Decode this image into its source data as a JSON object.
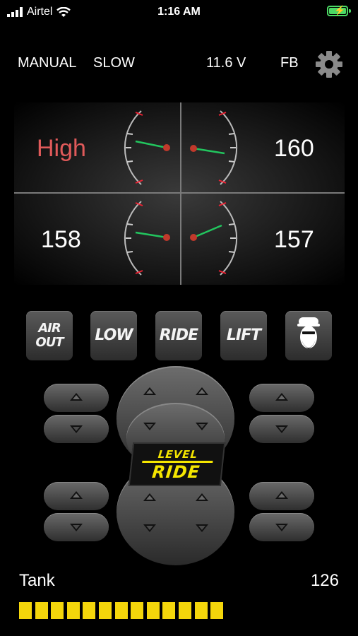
{
  "status_bar": {
    "carrier": "Airtel",
    "time": "1:16 AM"
  },
  "header": {
    "mode": "MANUAL",
    "speed": "SLOW",
    "voltage": "11.6 V",
    "mode_code": "FB"
  },
  "gauges": {
    "front_left": "High",
    "front_right": "160",
    "rear_left": "158",
    "rear_right": "157"
  },
  "presets": {
    "air_out_line1": "AIR",
    "air_out_line2": "OUT",
    "low": "LOW",
    "ride": "RIDE",
    "lift": "LIFT"
  },
  "logo": {
    "line1": "LEVEL",
    "line2": "RIDE"
  },
  "tank": {
    "label": "Tank",
    "value": "126",
    "segments_filled": 13
  },
  "colors": {
    "accent_yellow": "#f4d60b",
    "alert_red": "#e05a5a",
    "needle_green": "#22c55e",
    "battery_green": "#4cd964"
  }
}
